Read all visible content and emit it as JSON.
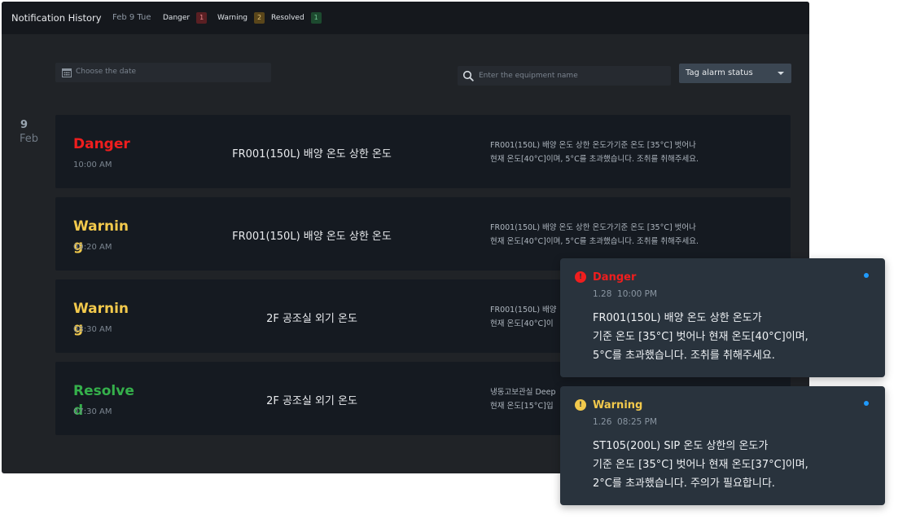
{
  "header": {
    "title": "Notification History",
    "date": "Feb 9 Tue",
    "stats": [
      {
        "label": "Danger",
        "count": "1"
      },
      {
        "label": "Warning",
        "count": "2"
      },
      {
        "label": "Resolved",
        "count": "1"
      }
    ]
  },
  "filters": {
    "date_placeholder": "Choose the date",
    "search_placeholder": "Enter the equipment name",
    "tag_status": "Tag alarm status"
  },
  "day": {
    "number": "9",
    "month": "Feb"
  },
  "notifications": [
    {
      "status": "Danger",
      "time": "10:00 AM",
      "title": "FR001(150L) 배양 온도 상한 온도",
      "desc": "FR001(150L) 배양 온도 상한 온도가기준 온도 [35°C] 벗어나\n현재 온도[40°C]이며, 5°C를 초과했습니다. 조취를 취해주세요."
    },
    {
      "status": "Warning",
      "time": "09:20 AM",
      "title": "FR001(150L) 배양 온도 상한 온도",
      "desc": "FR001(150L) 배양 온도 상한 온도가기준 온도 [35°C] 벗어나\n현재 온도[40°C]이며, 5°C를 초과했습니다. 조취를 취해주세요."
    },
    {
      "status": "Warning",
      "time": "08:30 AM",
      "title": "2F 공조실 외기 온도",
      "desc": "FR001(150L) 배양\n현재 온도[40°C]이"
    },
    {
      "status": "Resolved",
      "time": "07:30 AM",
      "title": "2F 공조실 외기 온도",
      "desc": "냉동고보관실 Deep\n현재 온도[15°C]입"
    }
  ],
  "toasts": [
    {
      "status": "Danger",
      "time": "1.28  10:00 PM",
      "message": "FR001(150L) 배양 온도 상한 온도가\n기준 온도 [35°C] 벗어나 현재 온도[40°C]이며,\n5°C를 초과했습니다. 조취를 취해주세요."
    },
    {
      "status": "Warning",
      "time": "1.26  08:25 PM",
      "message": "ST105(200L) SIP 온도 상한의 온도가\n기준 온도 [35°C] 벗어나 현재 온도[37°C]이며,\n2°C를 초과했습니다. 주의가 필요합니다."
    }
  ],
  "colors": {
    "danger": "#f01e1e",
    "warning": "#f2c94c",
    "resolved": "#35b04b",
    "unread_dot": "#1f9bff"
  },
  "icons": [
    "calendar-icon",
    "search-icon",
    "chevron-down-icon",
    "danger-alert-icon",
    "warning-alert-icon"
  ]
}
